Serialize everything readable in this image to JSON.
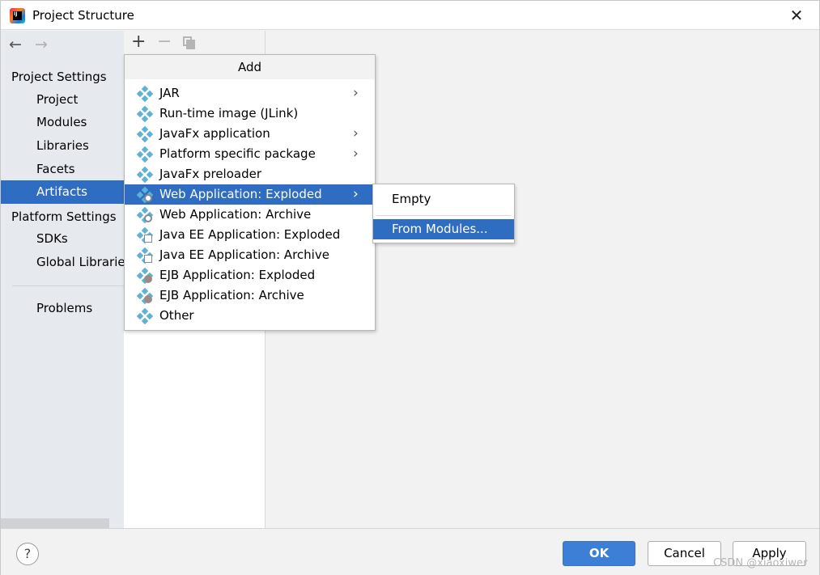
{
  "window": {
    "title": "Project Structure",
    "close_glyph": "✕"
  },
  "nav": {
    "back_glyph": "←",
    "forward_glyph": "→"
  },
  "sidebar": {
    "items": [
      {
        "label": "Project Settings",
        "type": "section"
      },
      {
        "label": "Project",
        "type": "child"
      },
      {
        "label": "Modules",
        "type": "child"
      },
      {
        "label": "Libraries",
        "type": "child"
      },
      {
        "label": "Facets",
        "type": "child"
      },
      {
        "label": "Artifacts",
        "type": "child",
        "selected": true
      },
      {
        "label": "Platform Settings",
        "type": "section"
      },
      {
        "label": "SDKs",
        "type": "child"
      },
      {
        "label": "Global Libraries",
        "type": "child"
      },
      {
        "label": "Problems",
        "type": "child"
      }
    ]
  },
  "toolbar": {
    "add_glyph": "+",
    "remove_glyph": "−"
  },
  "add_menu": {
    "header": "Add",
    "submenu_arrow": "›",
    "items": [
      {
        "label": "JAR",
        "has_submenu": true,
        "icon": "artifact-icon"
      },
      {
        "label": "Run-time image (JLink)",
        "has_submenu": false,
        "icon": "artifact-icon"
      },
      {
        "label": "JavaFx application",
        "has_submenu": true,
        "icon": "artifact-icon"
      },
      {
        "label": "Platform specific package",
        "has_submenu": true,
        "icon": "artifact-icon"
      },
      {
        "label": "JavaFx preloader",
        "has_submenu": false,
        "icon": "artifact-icon"
      },
      {
        "label": "Web Application: Exploded",
        "has_submenu": true,
        "icon": "web-artifact-icon",
        "highlighted": true
      },
      {
        "label": "Web Application: Archive",
        "has_submenu": false,
        "icon": "web-artifact-icon"
      },
      {
        "label": "Java EE Application: Exploded",
        "has_submenu": false,
        "icon": "javaee-artifact-icon"
      },
      {
        "label": "Java EE Application: Archive",
        "has_submenu": false,
        "icon": "javaee-artifact-icon"
      },
      {
        "label": "EJB Application: Exploded",
        "has_submenu": false,
        "icon": "ejb-artifact-icon"
      },
      {
        "label": "EJB Application: Archive",
        "has_submenu": false,
        "icon": "ejb-artifact-icon"
      },
      {
        "label": "Other",
        "has_submenu": false,
        "icon": "artifact-icon"
      }
    ]
  },
  "submenu": {
    "items": [
      {
        "label": "Empty"
      },
      {
        "label": "From Modules...",
        "highlighted": true
      }
    ]
  },
  "footer": {
    "help_glyph": "?",
    "ok_label": "OK",
    "cancel_label": "Cancel",
    "apply_label": "Apply",
    "watermark": "CSDN @xiaoxiwer"
  },
  "colors": {
    "selection": "#2f6dc3",
    "ok_button": "#3d7fd6",
    "sidebar_bg": "#e6eaef",
    "artifact_icon": "#5eb2d8"
  }
}
